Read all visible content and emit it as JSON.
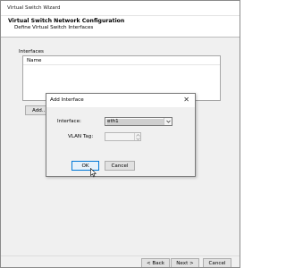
{
  "window": {
    "title": "Virtual Switch Wizard"
  },
  "header": {
    "title": "Virtual Switch Network Configuration",
    "subtitle": "Define Virtual Switch Interfaces"
  },
  "interfaces": {
    "group_label": "Interfaces",
    "columns": [
      "Name"
    ],
    "add_label": "Add..."
  },
  "footer": {
    "back_label": "< Back",
    "next_label": "Next >",
    "cancel_label": "Cancel"
  },
  "dialog": {
    "title": "Add Interface",
    "close_icon": "close-icon",
    "interface_label": "Interface:",
    "interface_value": "eth1",
    "vlan_label": "VLAN Tag:",
    "vlan_value": "",
    "ok_label": "OK",
    "cancel_label": "Cancel"
  },
  "colors": {
    "accent": "#0078d7",
    "selection": "#cfcfcf"
  }
}
